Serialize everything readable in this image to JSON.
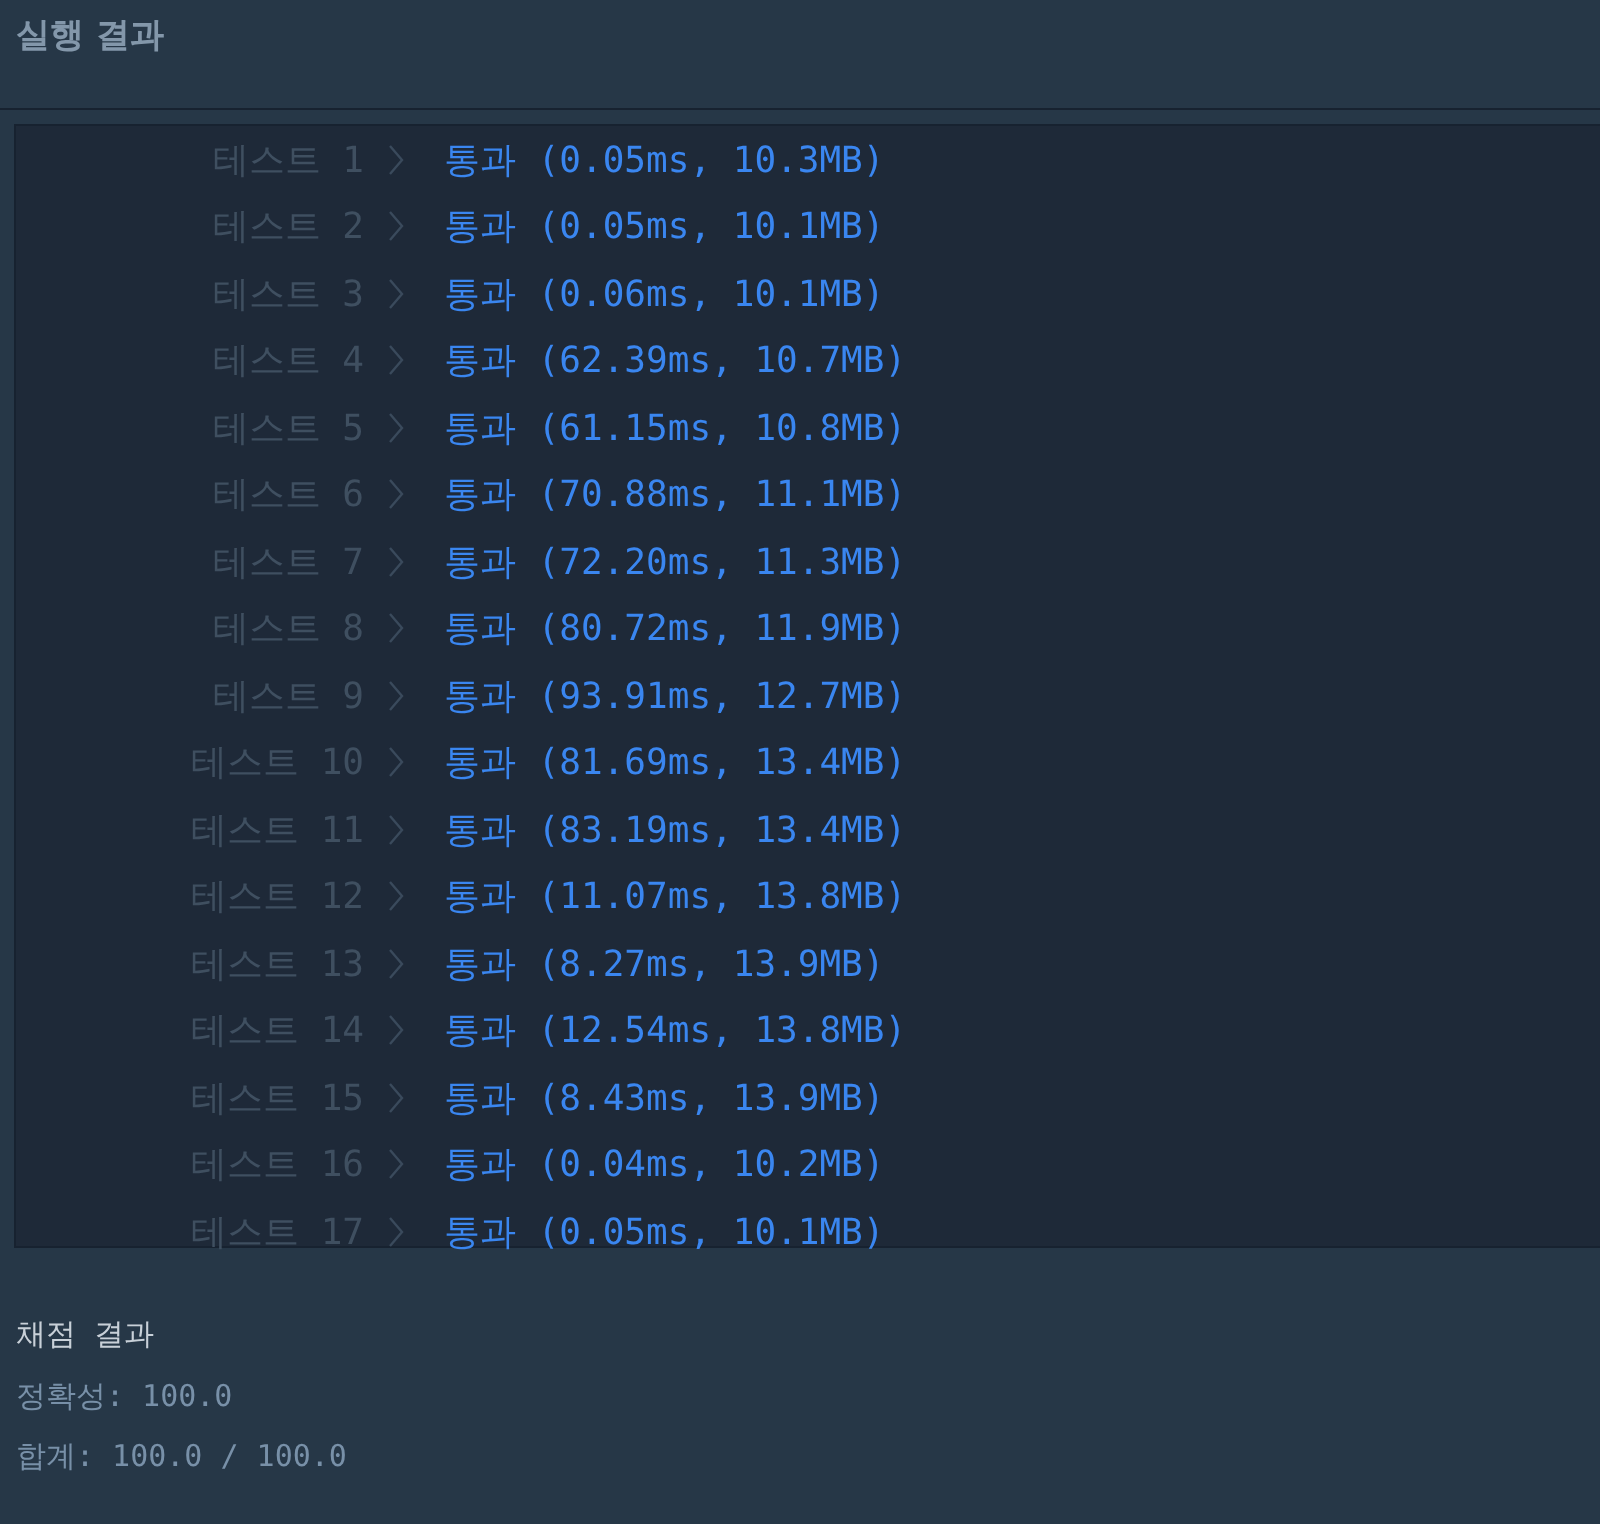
{
  "section_title": "실행 결과",
  "tests": [
    {
      "label": "테스트 1",
      "result": "통과 (0.05ms, 10.3MB)"
    },
    {
      "label": "테스트 2",
      "result": "통과 (0.05ms, 10.1MB)"
    },
    {
      "label": "테스트 3",
      "result": "통과 (0.06ms, 10.1MB)"
    },
    {
      "label": "테스트 4",
      "result": "통과 (62.39ms, 10.7MB)"
    },
    {
      "label": "테스트 5",
      "result": "통과 (61.15ms, 10.8MB)"
    },
    {
      "label": "테스트 6",
      "result": "통과 (70.88ms, 11.1MB)"
    },
    {
      "label": "테스트 7",
      "result": "통과 (72.20ms, 11.3MB)"
    },
    {
      "label": "테스트 8",
      "result": "통과 (80.72ms, 11.9MB)"
    },
    {
      "label": "테스트 9",
      "result": "통과 (93.91ms, 12.7MB)"
    },
    {
      "label": "테스트 10",
      "result": "통과 (81.69ms, 13.4MB)"
    },
    {
      "label": "테스트 11",
      "result": "통과 (83.19ms, 13.4MB)"
    },
    {
      "label": "테스트 12",
      "result": "통과 (11.07ms, 13.8MB)"
    },
    {
      "label": "테스트 13",
      "result": "통과 (8.27ms, 13.9MB)"
    },
    {
      "label": "테스트 14",
      "result": "통과 (12.54ms, 13.8MB)"
    },
    {
      "label": "테스트 15",
      "result": "통과 (8.43ms, 13.9MB)"
    },
    {
      "label": "테스트 16",
      "result": "통과 (0.04ms, 10.2MB)"
    },
    {
      "label": "테스트 17",
      "result": "통과 (0.05ms, 10.1MB)"
    }
  ],
  "grading": {
    "title": "채점 결과",
    "lines": [
      "정확성: 100.0",
      "합계: 100.0 / 100.0"
    ]
  }
}
